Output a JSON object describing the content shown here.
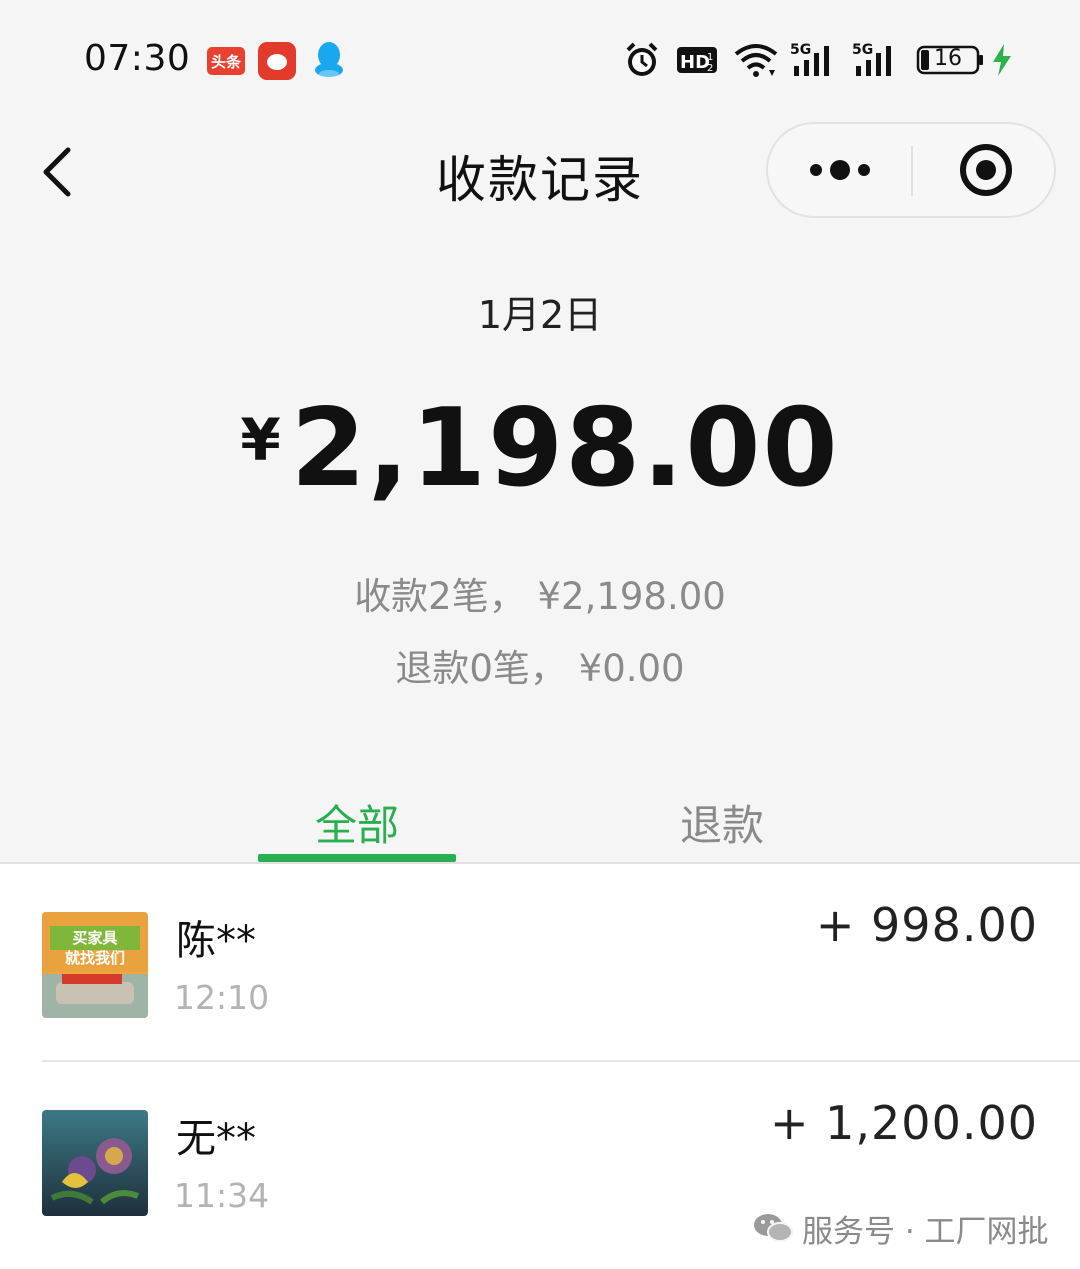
{
  "status_bar": {
    "time": "07:30",
    "app_badge_1": "头条",
    "battery_level": "16",
    "icons": [
      "toutiao-icon",
      "app-icon",
      "qq-icon",
      "alarm-icon",
      "hd-icon",
      "wifi-icon",
      "5g-signal-icon",
      "5g-signal-icon",
      "battery-icon",
      "charging-icon"
    ]
  },
  "nav": {
    "title": "收款记录",
    "back_icon": "chevron-left-icon",
    "more_icon": "more-dots-icon",
    "close_icon": "target-close-icon"
  },
  "summary": {
    "date": "1月2日",
    "currency": "¥",
    "total": "2,198.00",
    "received_line": "收款2笔， ¥2,198.00",
    "refund_line": "退款0笔， ¥0.00"
  },
  "tabs": {
    "all": "全部",
    "refund": "退款",
    "active": "all"
  },
  "transactions": [
    {
      "name": "陈**",
      "time": "12:10",
      "amount": "+ 998.00",
      "avatar_text": "买家具 就找我们"
    },
    {
      "name": "无**",
      "time": "11:34",
      "amount": "+ 1,200.00"
    }
  ],
  "watermark": "服务号 · 工厂网批",
  "colors": {
    "accent": "#2aae51",
    "background": "#f5f5f5",
    "muted_text": "#8a8a8a",
    "text": "#111111"
  }
}
